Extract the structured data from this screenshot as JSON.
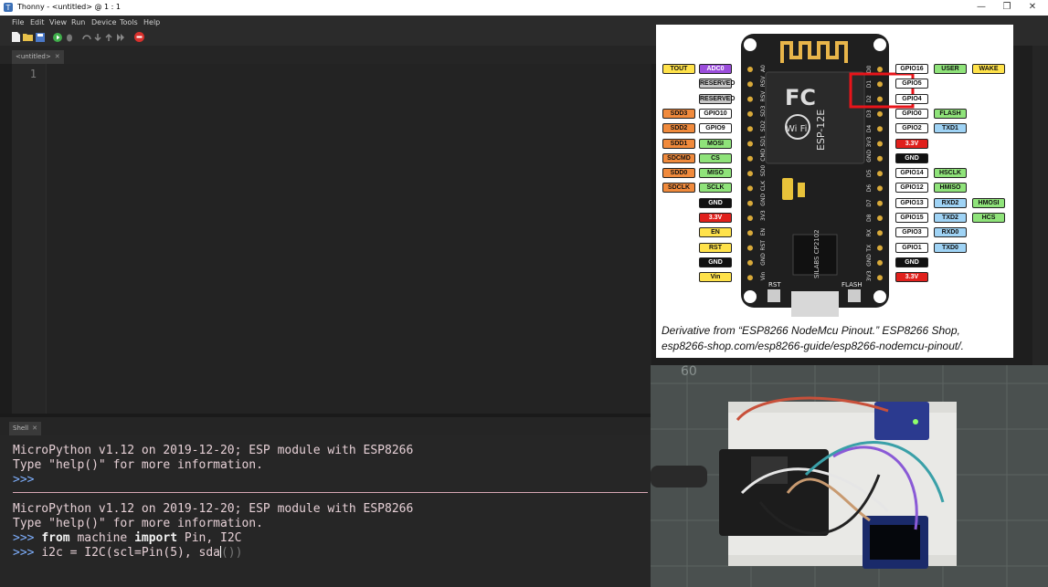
{
  "window": {
    "title": "Thonny  -  <untitled>  @  1 : 1",
    "controls": {
      "minimize": "—",
      "maximize": "❐",
      "close": "✕"
    }
  },
  "menu": [
    "File",
    "Edit",
    "View",
    "Run",
    "Device",
    "Tools",
    "Help"
  ],
  "toolbar": [
    "new-file-icon",
    "open-file-icon",
    "save-icon",
    "run-icon",
    "debug-icon",
    "step-over-icon",
    "step-into-icon",
    "step-out-icon",
    "resume-icon",
    "stop-icon"
  ],
  "editor": {
    "tab_label": "<untitled>",
    "tab_close": "✕",
    "line_numbers": [
      "1"
    ]
  },
  "shell": {
    "tab_label": "Shell",
    "tab_close": "✕",
    "banner1": "MicroPython v1.12 on 2019-12-20; ESP module with ESP8266",
    "help1": "Type \"help()\" for more information.",
    "prompt": ">>>",
    "banner2": "MicroPython v1.12 on 2019-12-20; ESP module with ESP8266",
    "help2": "Type \"help()\" for more information.",
    "cmd1_kw1": "from",
    "cmd1_mod": " machine ",
    "cmd1_kw2": "import",
    "cmd1_rest": " Pin, I2C",
    "cmd2_text": "i2c = I2C(scl=Pin(5), sda",
    "cmd2_ghost": "())"
  },
  "pinout": {
    "colors": {
      "orange": "#f08a3c",
      "purple": "#9b4ddb",
      "gray": "#c8c8c8",
      "green": "#8fe37a",
      "blue": "#9fd3f5",
      "red": "#e0201c",
      "black": "#111111",
      "yellow": "#ffe24a",
      "white": "#ffffff",
      "highlight": "#e8141a"
    },
    "board_text": {
      "brand": "FC",
      "module": "ESP-12E",
      "wifi": "Wi Fi",
      "chip": "SILABS CP2102",
      "rst": "RST",
      "flash": "FLASH"
    },
    "left_pins": [
      "A0",
      "RSV",
      "RSV",
      "SD3",
      "SD2",
      "SD1",
      "CMD",
      "SD0",
      "CLK",
      "GND",
      "3V3",
      "EN",
      "RST",
      "GND",
      "Vin"
    ],
    "right_pins": [
      "D0",
      "D1",
      "D2",
      "D3",
      "D4",
      "3V3",
      "GND",
      "D5",
      "D6",
      "D7",
      "D8",
      "RX",
      "TX",
      "GND",
      "3V3"
    ],
    "left_labels": [
      [
        {
          "t": "TOUT",
          "c": "yellow"
        },
        {
          "t": "ADC0",
          "c": "purple"
        }
      ],
      [
        {
          "t": "RESERVED",
          "c": "gray"
        }
      ],
      [
        {
          "t": "RESERVED",
          "c": "gray"
        }
      ],
      [
        {
          "t": "SDD3",
          "c": "orange"
        },
        {
          "t": "GPIO10",
          "c": "white"
        }
      ],
      [
        {
          "t": "SDD2",
          "c": "orange"
        },
        {
          "t": "GPIO9",
          "c": "white"
        }
      ],
      [
        {
          "t": "SDD1",
          "c": "orange"
        },
        {
          "t": "MOSI",
          "c": "green"
        }
      ],
      [
        {
          "t": "SDCMD",
          "c": "orange"
        },
        {
          "t": "CS",
          "c": "green"
        }
      ],
      [
        {
          "t": "SDD0",
          "c": "orange"
        },
        {
          "t": "MISO",
          "c": "green"
        }
      ],
      [
        {
          "t": "SDCLK",
          "c": "orange"
        },
        {
          "t": "SCLK",
          "c": "green"
        }
      ],
      [
        {
          "t": "GND",
          "c": "black"
        }
      ],
      [
        {
          "t": "3.3V",
          "c": "red"
        }
      ],
      [
        {
          "t": "EN",
          "c": "yellow"
        }
      ],
      [
        {
          "t": "RST",
          "c": "yellow"
        }
      ],
      [
        {
          "t": "GND",
          "c": "black"
        }
      ],
      [
        {
          "t": "Vin",
          "c": "yellow"
        }
      ]
    ],
    "right_labels": [
      [
        {
          "t": "GPIO16",
          "c": "white"
        },
        {
          "t": "USER",
          "c": "green"
        },
        {
          "t": "WAKE",
          "c": "yellow"
        }
      ],
      [
        {
          "t": "GPIO5",
          "c": "white"
        }
      ],
      [
        {
          "t": "GPIO4",
          "c": "white"
        }
      ],
      [
        {
          "t": "GPIO0",
          "c": "white"
        },
        {
          "t": "FLASH",
          "c": "green"
        }
      ],
      [
        {
          "t": "GPIO2",
          "c": "white"
        },
        {
          "t": "TXD1",
          "c": "blue"
        }
      ],
      [
        {
          "t": "3.3V",
          "c": "red"
        }
      ],
      [
        {
          "t": "GND",
          "c": "black"
        }
      ],
      [
        {
          "t": "GPIO14",
          "c": "white"
        },
        {
          "t": "HSCLK",
          "c": "green"
        }
      ],
      [
        {
          "t": "GPIO12",
          "c": "white"
        },
        {
          "t": "HMISO",
          "c": "green"
        }
      ],
      [
        {
          "t": "GPIO13",
          "c": "white"
        },
        {
          "t": "RXD2",
          "c": "blue"
        },
        {
          "t": "HMOSI",
          "c": "green"
        }
      ],
      [
        {
          "t": "GPIO15",
          "c": "white"
        },
        {
          "t": "TXD2",
          "c": "blue"
        },
        {
          "t": "HCS",
          "c": "green"
        }
      ],
      [
        {
          "t": "GPIO3",
          "c": "white"
        },
        {
          "t": "RXD0",
          "c": "blue"
        }
      ],
      [
        {
          "t": "GPIO1",
          "c": "white"
        },
        {
          "t": "TXD0",
          "c": "blue"
        }
      ],
      [
        {
          "t": "GND",
          "c": "black"
        }
      ],
      [
        {
          "t": "3.3V",
          "c": "red"
        }
      ]
    ],
    "caption": "Derivative from “ESP8266 NodeMcu Pinout.” ESP8266 Shop, esp8266-shop.com/esp8266-guide/esp8266-nodemcu-pinout/."
  },
  "photo": {
    "ruler_mark": "60"
  }
}
